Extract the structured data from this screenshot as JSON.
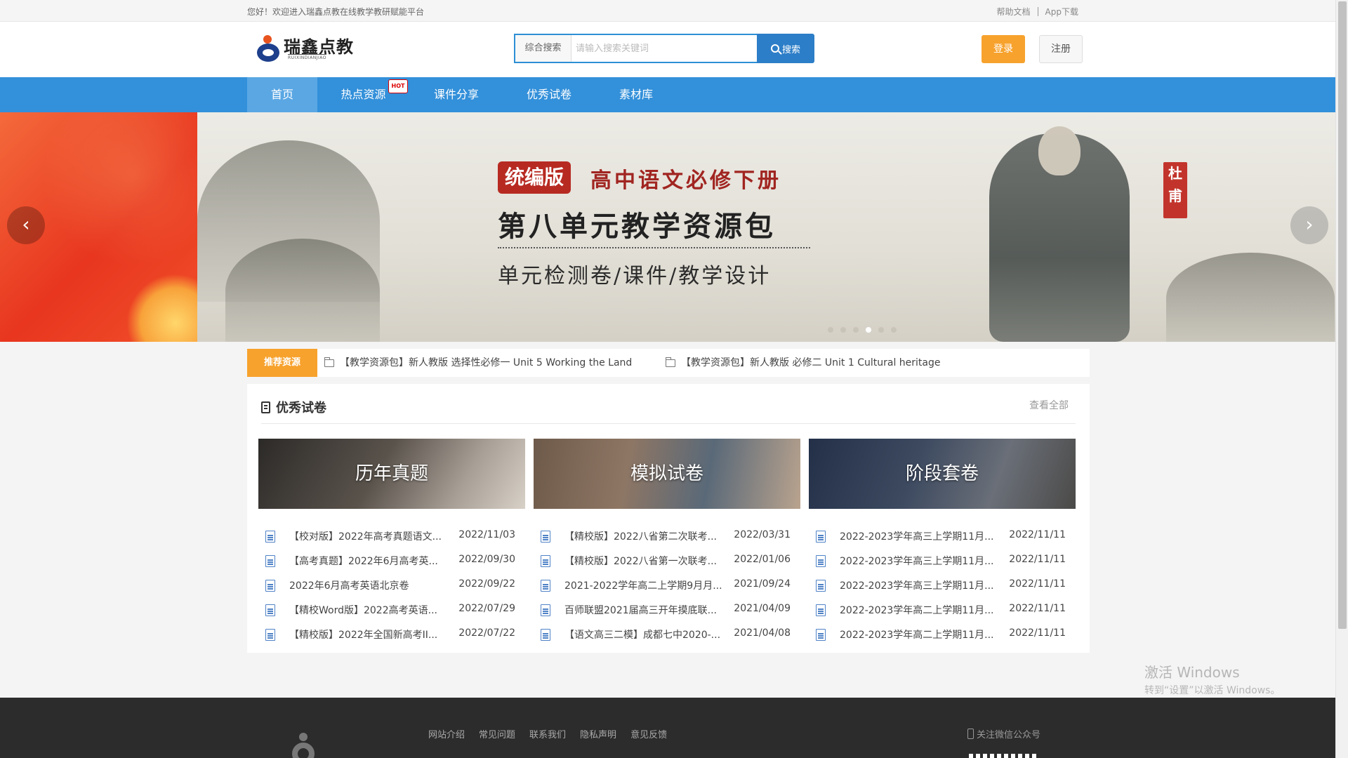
{
  "topbar": {
    "welcome": "您好！欢迎进入瑞鑫点教在线教学教研赋能平台",
    "help": "帮助文档",
    "app": "App下载"
  },
  "logo": {
    "title": "瑞鑫点教",
    "subtitle": "RUIXINDIANJIAO"
  },
  "search": {
    "scope": "综合搜索",
    "placeholder": "请输入搜索关键词",
    "button": "搜索"
  },
  "auth": {
    "login": "登录",
    "register": "注册"
  },
  "nav": {
    "items": [
      "首页",
      "热点资源",
      "课件分享",
      "优秀试卷",
      "素材库"
    ],
    "hot_badge": "HOT",
    "active": "首页"
  },
  "banner": {
    "tag": "统编版",
    "line1": "高中语文必修下册",
    "line2": "第八单元教学资源包",
    "line3": "单元检测卷/课件/教学设计",
    "seal": "杜甫",
    "dot_count": 6,
    "active_dot": 4
  },
  "recommend": {
    "label": "推荐资源",
    "items": [
      "【教学资源包】新人教版 选择性必修一 Unit 5 Working the Land",
      "【教学资源包】新人教版 必修二 Unit 1 Cultural heritage"
    ]
  },
  "panel": {
    "title": "优秀试卷",
    "more": "查看全部",
    "categories": [
      {
        "name": "历年真题",
        "items": [
          {
            "title": "【校对版】2022年高考真题语文...",
            "date": "2022/11/03"
          },
          {
            "title": "【高考真题】2022年6月高考英...",
            "date": "2022/09/30"
          },
          {
            "title": "2022年6月高考英语北京卷",
            "date": "2022/09/22"
          },
          {
            "title": "【精校Word版】2022高考英语...",
            "date": "2022/07/29"
          },
          {
            "title": "【精校版】2022年全国新高考II...",
            "date": "2022/07/22"
          }
        ]
      },
      {
        "name": "模拟试卷",
        "items": [
          {
            "title": "【精校版】2022八省第二次联考...",
            "date": "2022/03/31"
          },
          {
            "title": "【精校版】2022八省第一次联考...",
            "date": "2022/01/06"
          },
          {
            "title": "2021-2022学年高二上学期9月月...",
            "date": "2021/09/24"
          },
          {
            "title": "百师联盟2021届高三开年摸底联...",
            "date": "2021/04/09"
          },
          {
            "title": "【语文高三二模】成都七中2020-...",
            "date": "2021/04/08"
          }
        ]
      },
      {
        "name": "阶段套卷",
        "items": [
          {
            "title": "2022-2023学年高三上学期11月...",
            "date": "2022/11/11"
          },
          {
            "title": "2022-2023学年高三上学期11月...",
            "date": "2022/11/11"
          },
          {
            "title": "2022-2023学年高三上学期11月...",
            "date": "2022/11/11"
          },
          {
            "title": "2022-2023学年高二上学期11月...",
            "date": "2022/11/11"
          },
          {
            "title": "2022-2023学年高二上学期11月...",
            "date": "2022/11/11"
          }
        ]
      }
    ]
  },
  "watermark": {
    "line1": "激活 Windows",
    "line2": "转到“设置”以激活 Windows。"
  },
  "footer": {
    "links": [
      "网站介绍",
      "常见问题",
      "联系我们",
      "隐私声明",
      "意见反馈"
    ],
    "wechat": "关注微信公众号"
  },
  "colors": {
    "brand_blue": "#3390da",
    "accent_orange": "#f7a22d"
  }
}
